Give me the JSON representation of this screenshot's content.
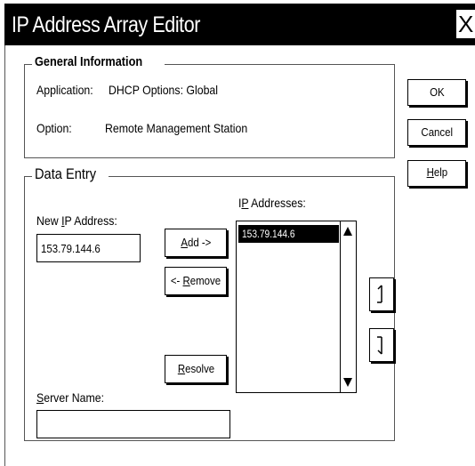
{
  "window": {
    "title": "IP Address Array Editor",
    "close_glyph": "X"
  },
  "general": {
    "legend": "General Information",
    "application_label": "Application:",
    "application_value": "DHCP Options: Global",
    "option_label": "Option:",
    "option_value": "Remote Management Station"
  },
  "buttons": {
    "ok": "OK",
    "cancel": "Cancel",
    "help_hot": "H",
    "help_rest": "elp"
  },
  "data_entry": {
    "legend": "Data Entry",
    "new_ip_label_pre": "New ",
    "new_ip_label_hot": "I",
    "new_ip_label_post": "P Address:",
    "new_ip_value": "153.79.144.6",
    "add_hot": "A",
    "add_rest": "dd ->",
    "remove_pre": "<- ",
    "remove_hot": "R",
    "remove_rest": "emove",
    "resolve_hot": "R",
    "resolve_rest": "esolve",
    "server_label_hot": "S",
    "server_label_rest": "erver Name:",
    "server_value": "",
    "ip_list_label_pre": "I",
    "ip_list_label_hot": "P",
    "ip_list_label_post": " Addresses:",
    "ip_list": [
      "153.79.144.6"
    ]
  },
  "icons": {
    "move_up": "move-up-icon",
    "move_down": "move-down-icon"
  }
}
